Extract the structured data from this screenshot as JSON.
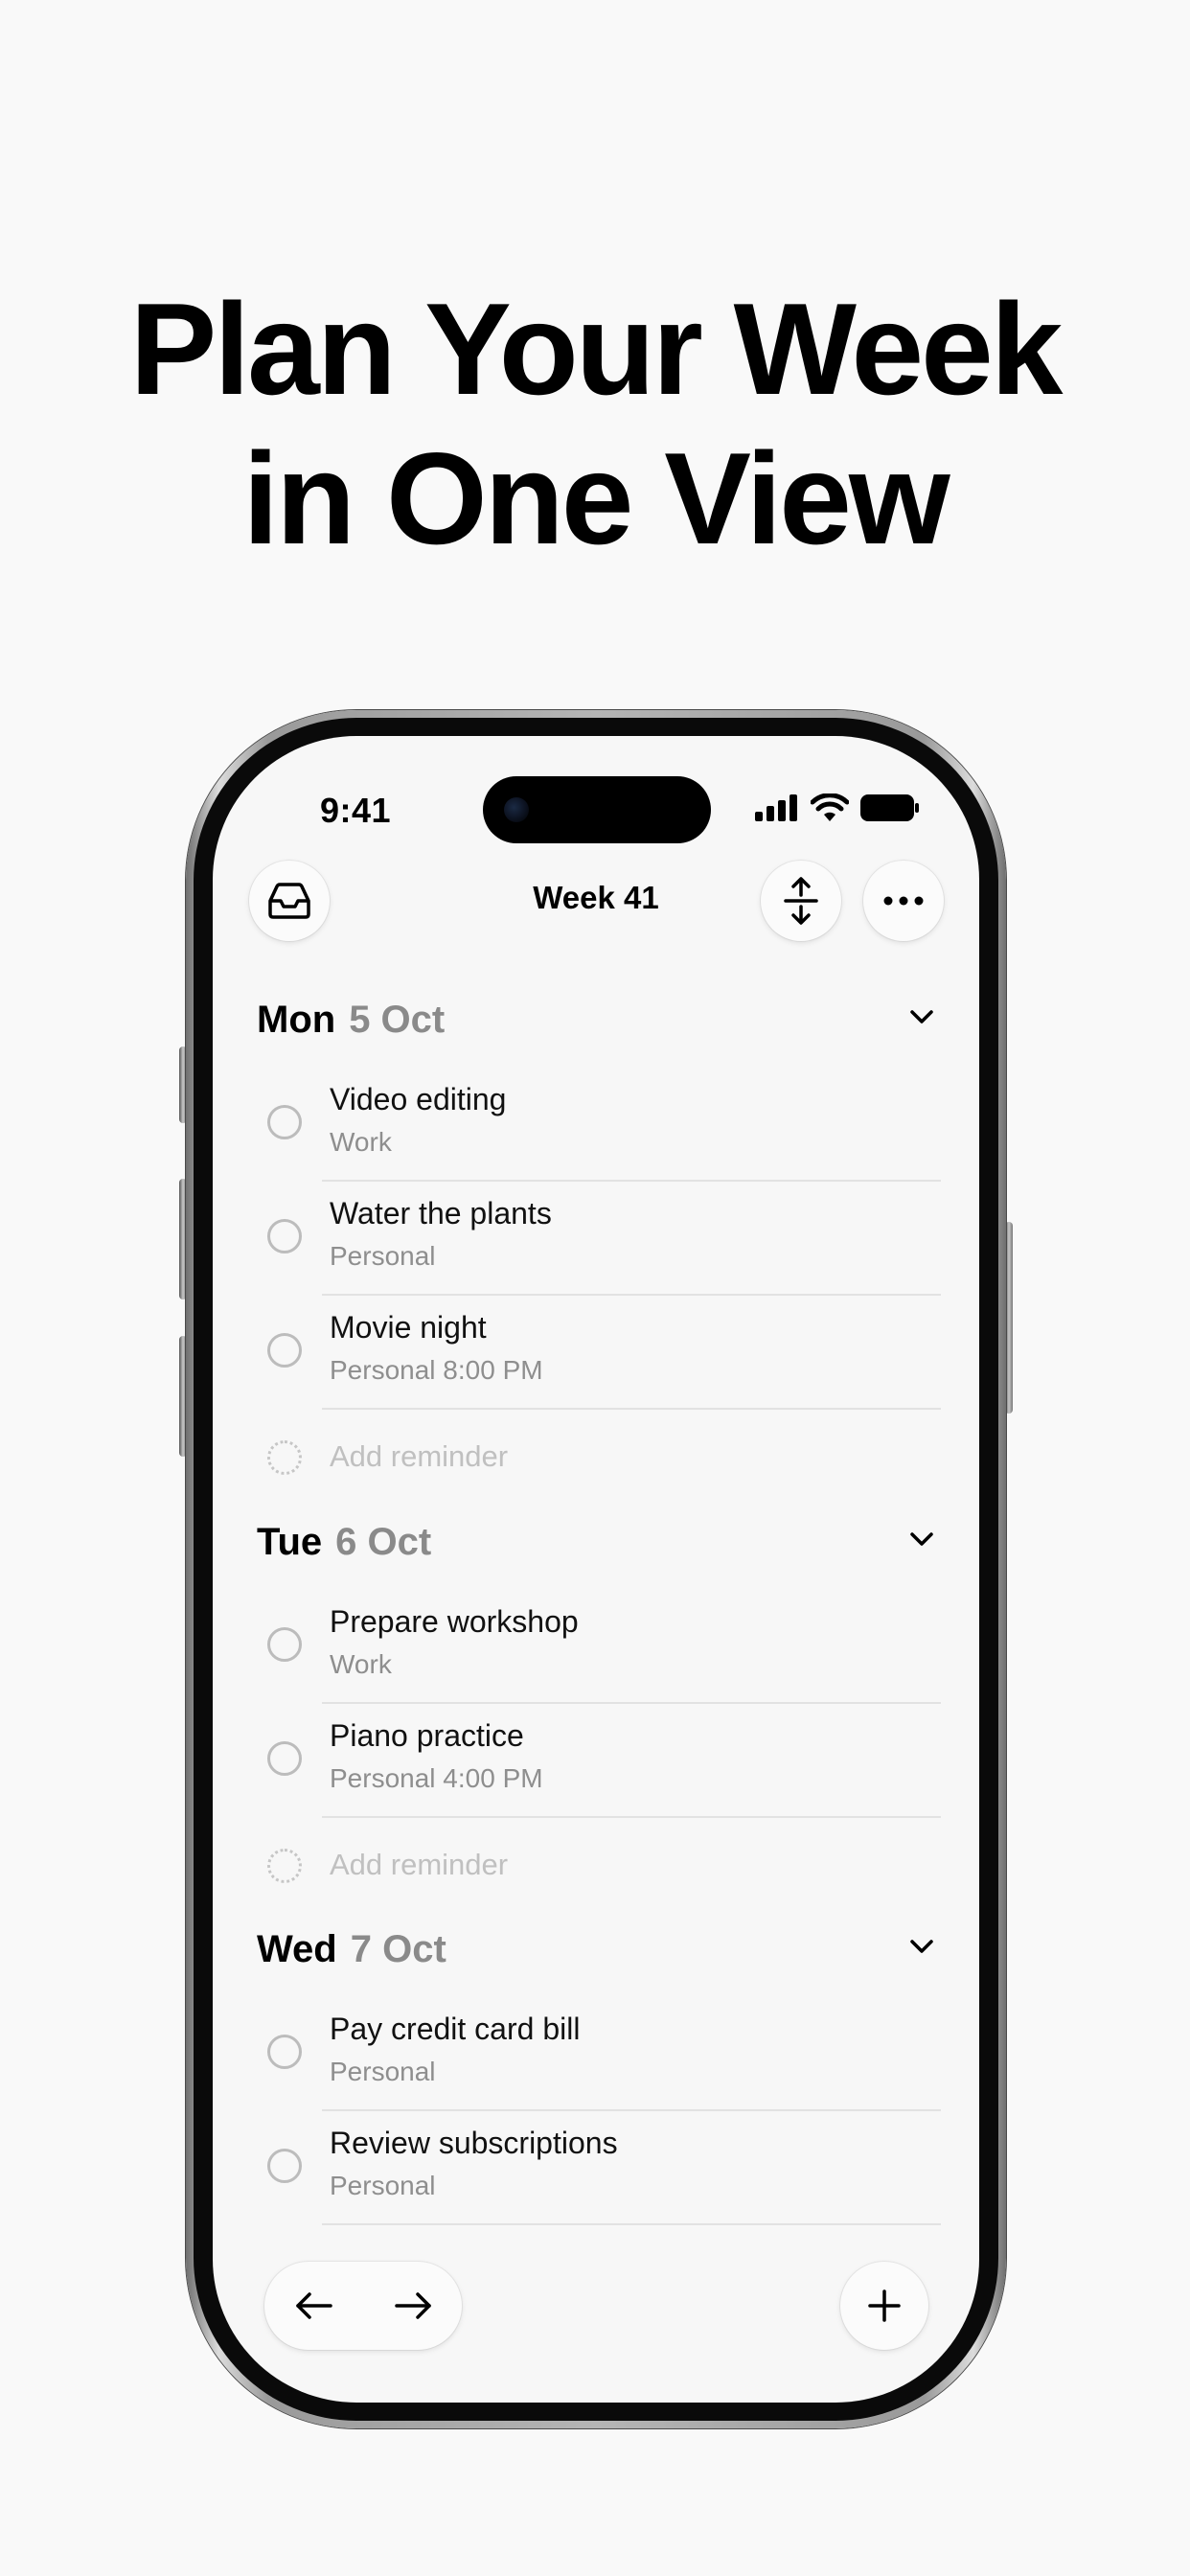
{
  "headline": {
    "line1": "Plan Your Week",
    "line2": "in One View"
  },
  "status_bar": {
    "time": "9:41",
    "icons": [
      "cellular-signal-icon",
      "wifi-icon",
      "battery-icon"
    ]
  },
  "nav": {
    "title": "Week 41",
    "left_icon": "inbox-tray-icon",
    "right_icons": [
      "expand-collapse-icon",
      "more-ellipsis-icon"
    ]
  },
  "days": [
    {
      "name": "Mon",
      "date": "5 Oct",
      "tasks": [
        {
          "title": "Video editing",
          "meta": "Work"
        },
        {
          "title": "Water the plants",
          "meta": "Personal"
        },
        {
          "title": "Movie night",
          "meta": "Personal  8:00 PM"
        }
      ],
      "add_label": "Add reminder"
    },
    {
      "name": "Tue",
      "date": "6 Oct",
      "tasks": [
        {
          "title": "Prepare workshop",
          "meta": "Work"
        },
        {
          "title": "Piano practice",
          "meta": "Personal  4:00 PM"
        }
      ],
      "add_label": "Add reminder"
    },
    {
      "name": "Wed",
      "date": "7 Oct",
      "tasks": [
        {
          "title": "Pay credit card bill",
          "meta": "Personal"
        },
        {
          "title": "Review subscriptions",
          "meta": "Personal"
        }
      ]
    }
  ],
  "toolbar": {
    "prev_icon": "arrow-left-icon",
    "next_icon": "arrow-right-icon",
    "add_icon": "plus-icon"
  }
}
